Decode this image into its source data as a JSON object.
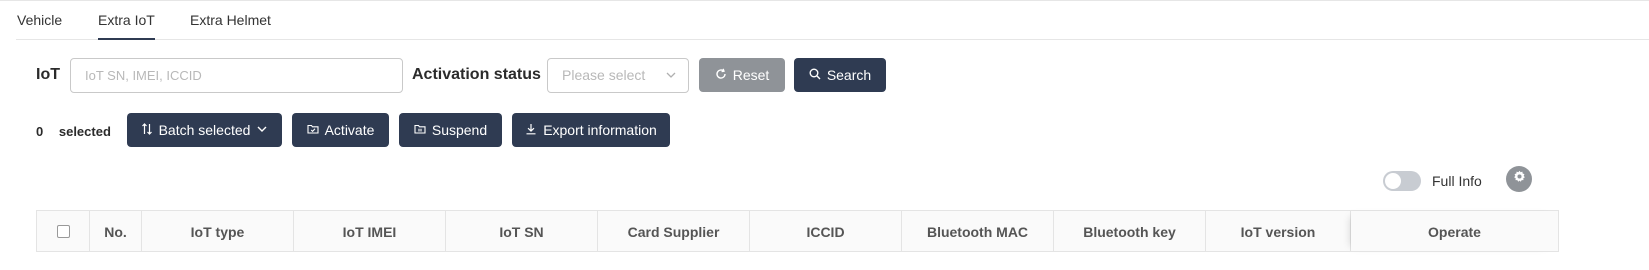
{
  "tabs": [
    {
      "label": "Vehicle",
      "active": false
    },
    {
      "label": "Extra IoT",
      "active": true
    },
    {
      "label": "Extra Helmet",
      "active": false
    }
  ],
  "filters": {
    "iot_label": "IoT",
    "iot_placeholder": "IoT SN, IMEI, ICCID",
    "activation_label": "Activation status",
    "activation_placeholder": "Please select",
    "reset_label": "Reset",
    "search_label": "Search"
  },
  "toolbar": {
    "selected_count": "0",
    "selected_label": "selected",
    "batch_label": "Batch selected",
    "activate_label": "Activate",
    "suspend_label": "Suspend",
    "export_label": "Export information"
  },
  "view": {
    "full_info_label": "Full Info",
    "full_info_on": false
  },
  "table": {
    "columns": [
      "No.",
      "IoT type",
      "IoT IMEI",
      "IoT SN",
      "Card Supplier",
      "ICCID",
      "Bluetooth MAC",
      "Bluetooth key",
      "IoT version",
      "Operate"
    ]
  },
  "colors": {
    "primary": "#2f3b52",
    "secondary": "#8f9398"
  }
}
